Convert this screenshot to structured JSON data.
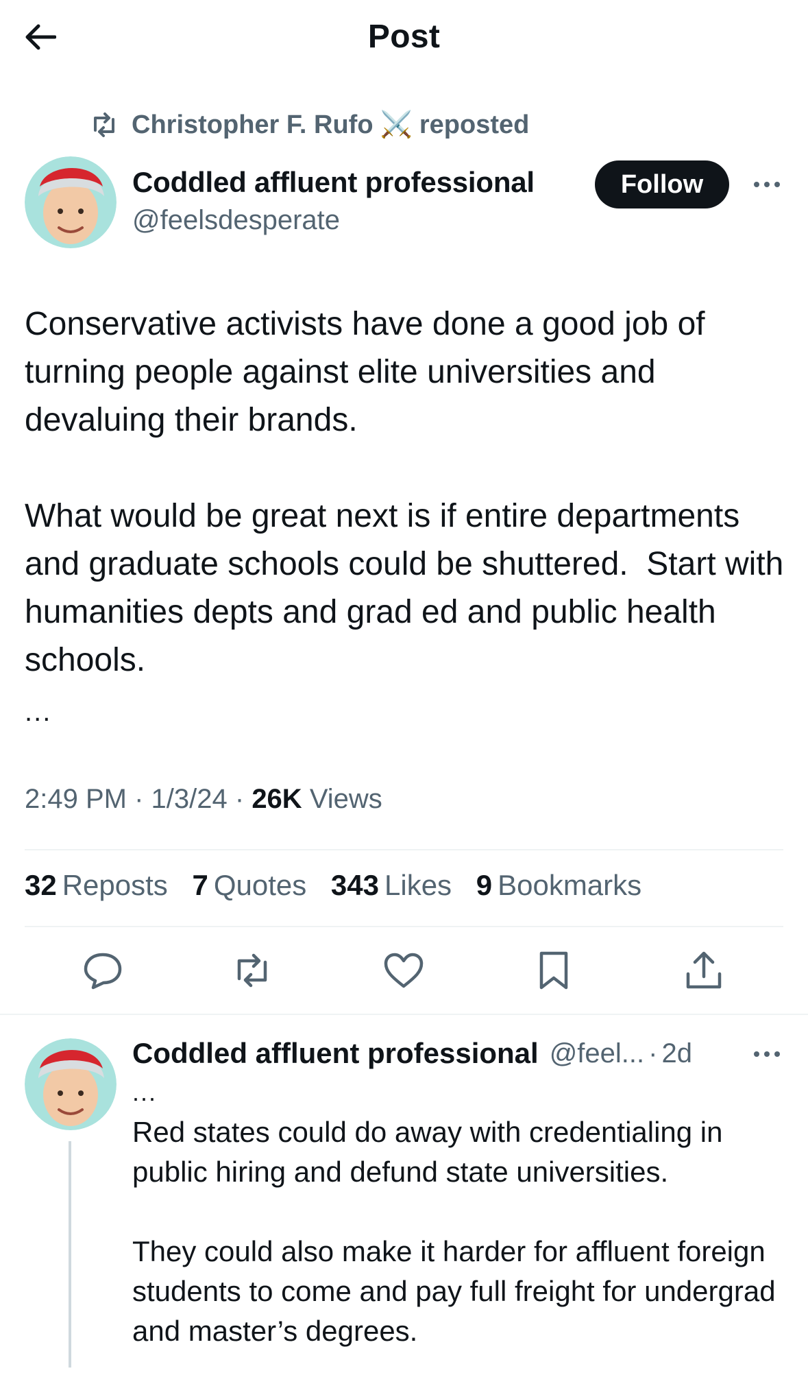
{
  "header": {
    "title": "Post"
  },
  "repost": {
    "reposter": "Christopher F. Rufo",
    "emoji": "⚔️",
    "suffix": "reposted"
  },
  "post": {
    "author_name": "Coddled affluent professional",
    "author_handle": "@feelsdesperate",
    "follow_label": "Follow",
    "paragraphs": [
      "Conservative activists have done a good job of turning people against elite universities and devaluing their brands.",
      "What would be great next is if entire departments and graduate schools could be shuttered.  Start with humanities depts and grad ed and public health schools."
    ],
    "truncation": "...",
    "time": "2:49 PM",
    "date": "1/3/24",
    "views_count": "26K",
    "views_label": "Views"
  },
  "stats": {
    "reposts": {
      "count": "32",
      "label": "Reposts"
    },
    "quotes": {
      "count": "7",
      "label": "Quotes"
    },
    "likes": {
      "count": "343",
      "label": "Likes"
    },
    "bookmarks": {
      "count": "9",
      "label": "Bookmarks"
    }
  },
  "actions": [
    "reply-icon",
    "repost-icon",
    "like-icon",
    "bookmark-icon",
    "share-icon"
  ],
  "reply": {
    "author_name": "Coddled affluent professional",
    "author_handle": "@feel...",
    "age": "2d",
    "truncation": "...",
    "paragraphs": [
      "Red states could do away with credentialing in public hiring and defund state universities.",
      "They could also make it harder for affluent foreign students to come and pay full freight for undergrad and master’s degrees."
    ]
  },
  "colors": {
    "text_primary": "#0f1419",
    "text_secondary": "#536471",
    "divider": "#eff3f4",
    "thread_line": "#cfd9de",
    "follow_bg": "#0f1419"
  }
}
